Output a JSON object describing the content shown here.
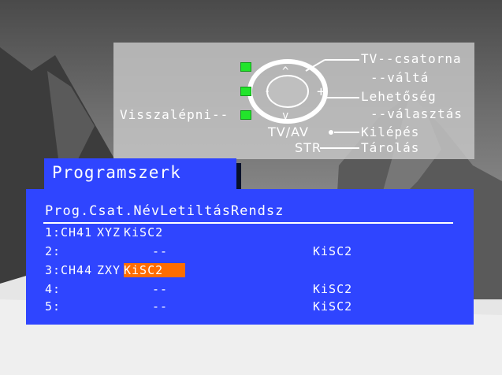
{
  "help": {
    "tv": "TV--csatorna",
    "valta": "--váltá",
    "lehetoseg": "Lehetőség",
    "valasztas": "--választás",
    "vissza": "Visszalépni--",
    "tvav": "TV/AV",
    "kilepes": "Kilépés",
    "str": "STR",
    "tarolas": "Tárolás",
    "dpad_up": "^",
    "dpad_down": "v",
    "dpad_left": "-",
    "dpad_right": "+"
  },
  "menu": {
    "title": "Programszerk",
    "header": "Prog.Csat.NévLetiltásRendsz",
    "rows": [
      {
        "num": "1:",
        "csat": "CH41",
        "nev": "XYZ",
        "rendsz": "KiSC2",
        "inline": true
      },
      {
        "num": "2:",
        "csat": "--",
        "nev": "",
        "rendsz": "KiSC2",
        "inline": false
      },
      {
        "num": "3:",
        "csat": "CH44",
        "nev": "ZXY",
        "rendsz": "KiSC2",
        "inline": true,
        "selected": true
      },
      {
        "num": "4:",
        "csat": "--",
        "nev": "",
        "rendsz": "KiSC2",
        "inline": false
      },
      {
        "num": "5:",
        "csat": "--",
        "nev": "",
        "rendsz": "KiSC2",
        "inline": false
      }
    ]
  },
  "colors": {
    "menu_bg": "#2f45ff",
    "highlight": "#ff6d00",
    "indicator": "#22e52b"
  }
}
